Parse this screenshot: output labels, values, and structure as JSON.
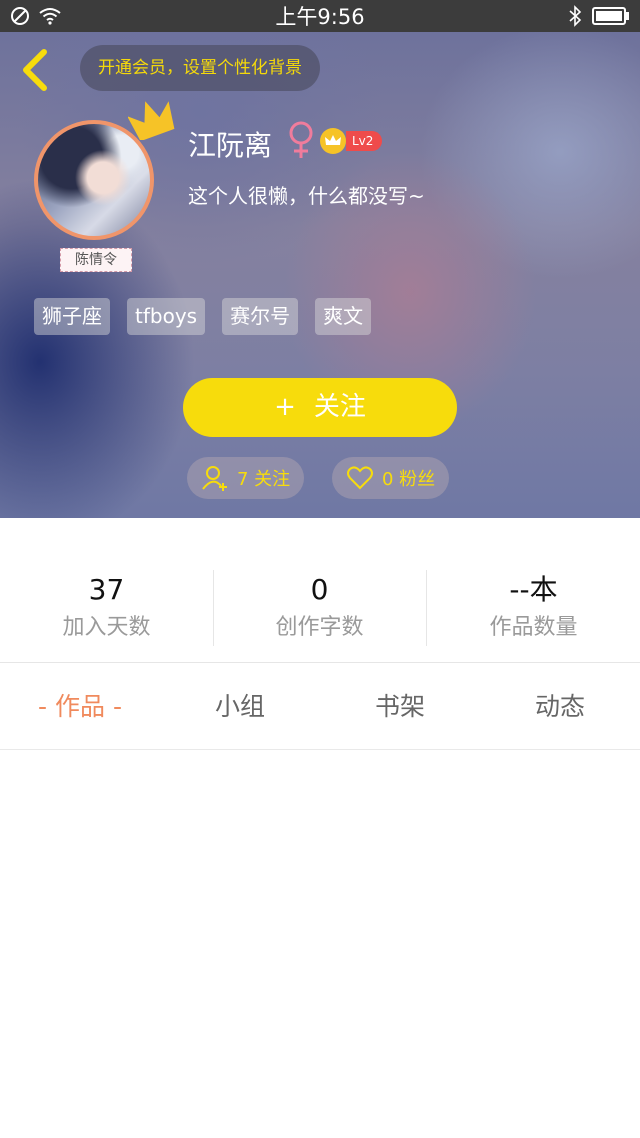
{
  "status_bar": {
    "time": "上午9:56",
    "icons": [
      "no-sim-icon",
      "wifi-icon",
      "bluetooth-icon",
      "battery-icon"
    ]
  },
  "header": {
    "vip_banner": "开通会员，设置个性化背景",
    "username": "江阮离",
    "gender_symbol": "♀",
    "level": "Lv2",
    "bio": "这个人很懒，什么都没写~",
    "avatar_tag": "陈情令",
    "tags": [
      "狮子座",
      "tfboys",
      "赛尔号",
      "爽文"
    ],
    "follow_button": {
      "plus": "+",
      "label": "关注"
    },
    "following": "7 关注",
    "fans": "0 粉丝"
  },
  "stats": [
    {
      "value": "37",
      "label": "加入天数"
    },
    {
      "value": "0",
      "label": "创作字数"
    },
    {
      "value": "--本",
      "label": "作品数量"
    }
  ],
  "tabs": [
    {
      "label": "- 作品 -",
      "active": true
    },
    {
      "label": "小组",
      "active": false
    },
    {
      "label": "书架",
      "active": false
    },
    {
      "label": "动态",
      "active": false
    }
  ],
  "colors": {
    "accent_yellow": "#f7dc0c",
    "active_tab": "#f08a5d",
    "level_badge": "#ef4b4b",
    "avatar_border": "#f0956a"
  }
}
